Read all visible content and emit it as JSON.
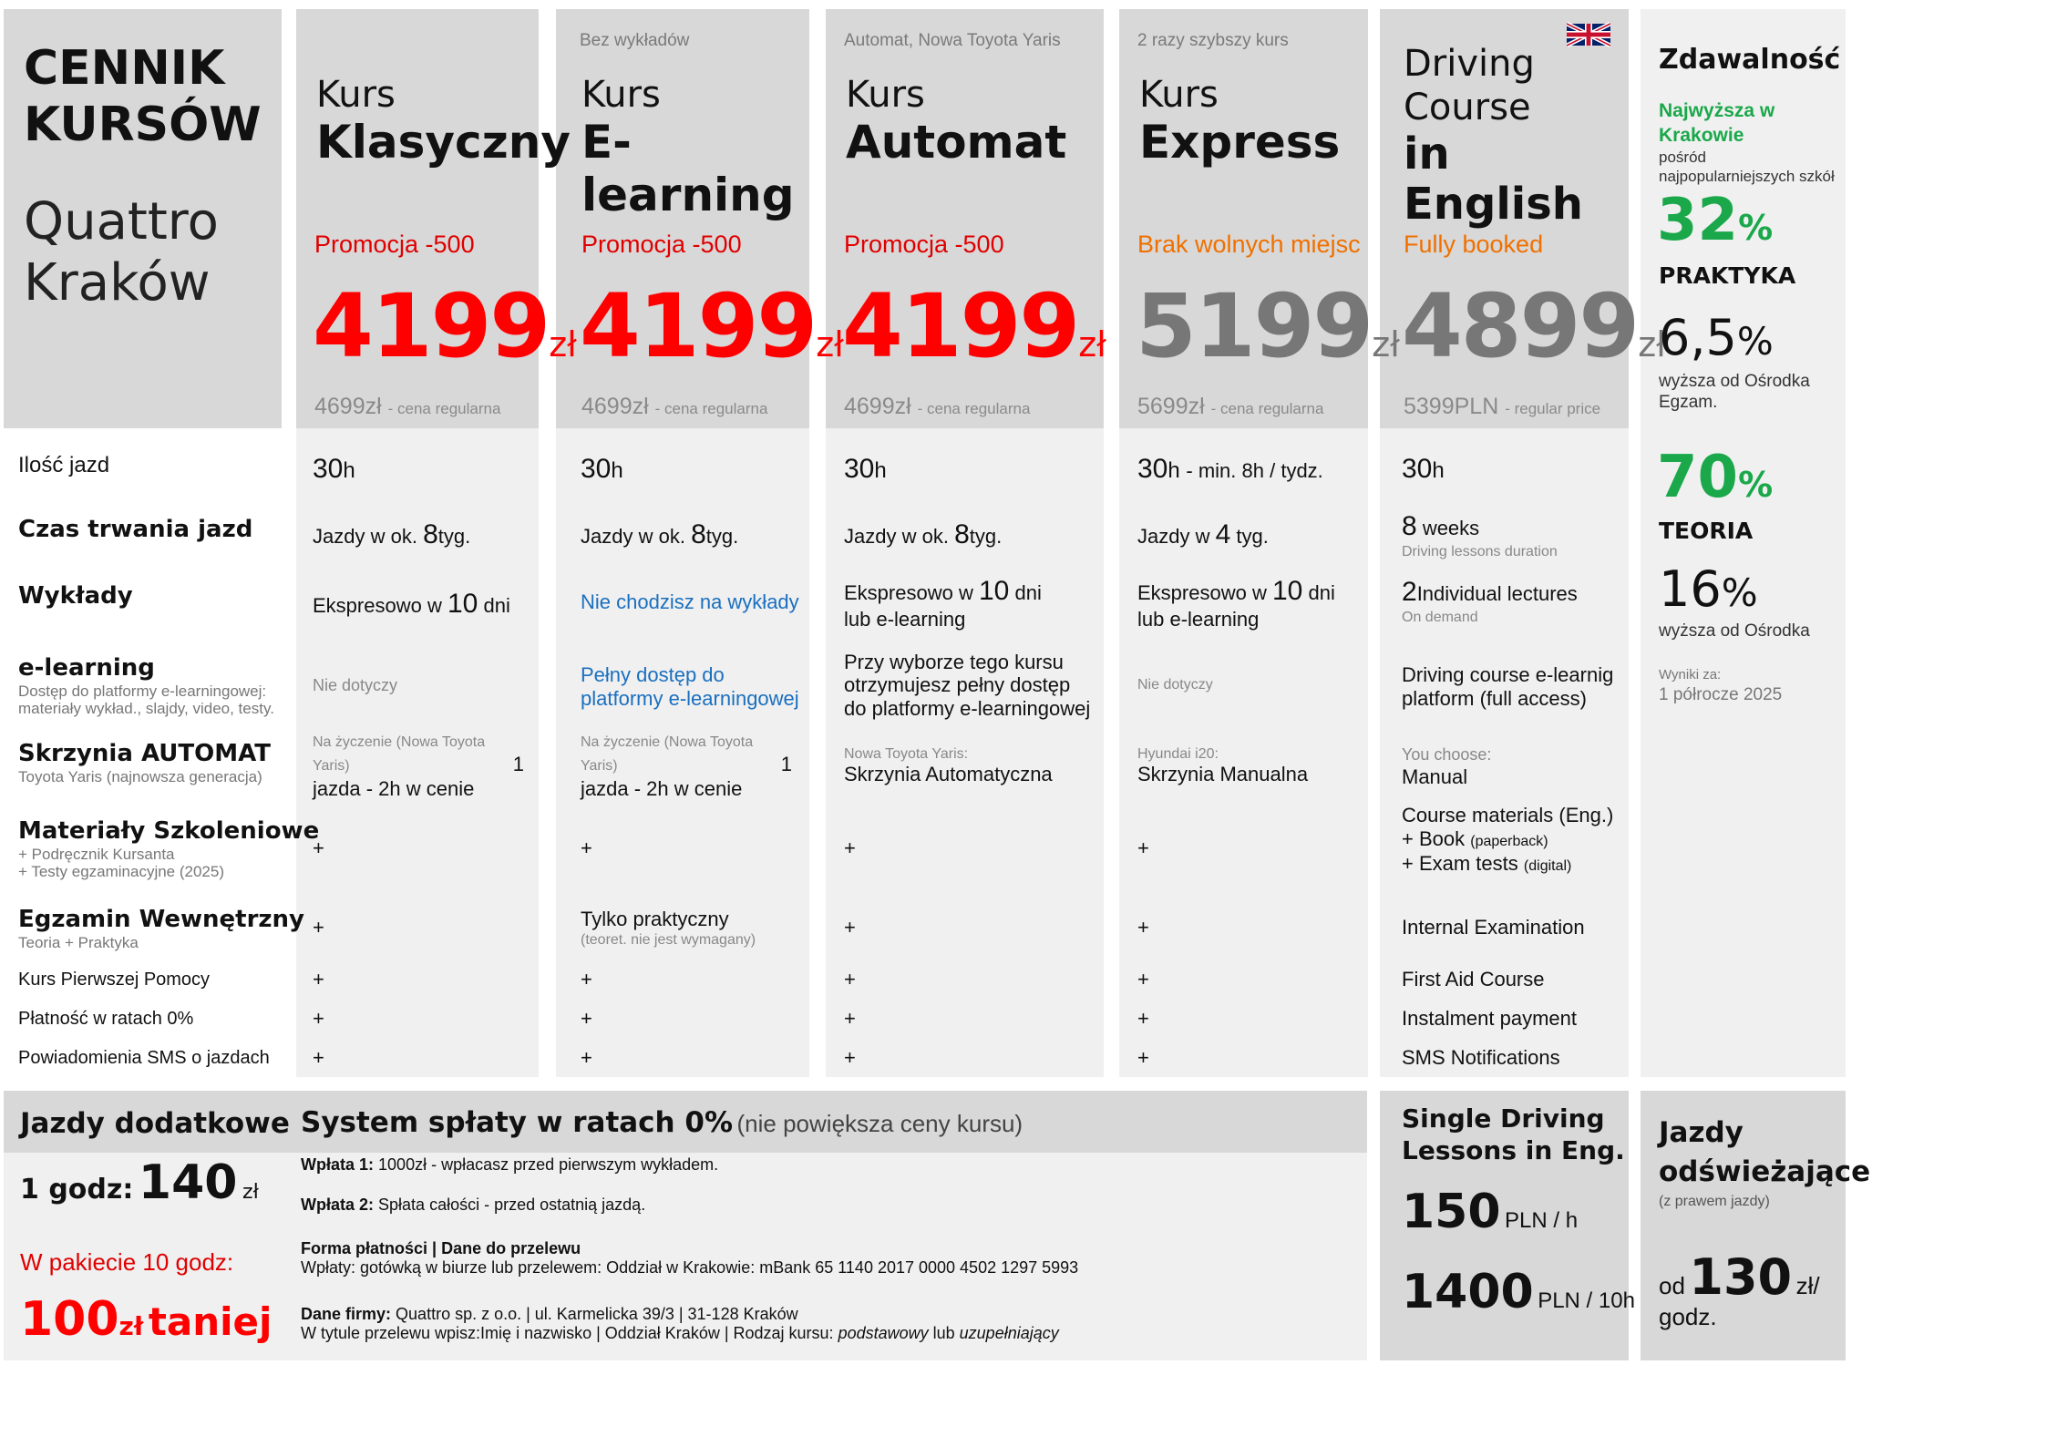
{
  "title": {
    "line1": "CENNIK",
    "line2": "KURSÓW",
    "sub1": "Quattro",
    "sub2": "Kraków"
  },
  "courses": [
    {
      "sup": "",
      "l1": "Kurs",
      "l2": "Klasyczny",
      "l3": "",
      "promo": "Promocja -500",
      "price": "4199",
      "unit": "zł",
      "reg": "4699zł",
      "reg_note": "- cena regularna"
    },
    {
      "sup": "Bez wykładów",
      "l1": "Kurs",
      "l2": "E-learning",
      "l3": "",
      "promo": "Promocja -500",
      "price": "4199",
      "unit": "zł",
      "reg": "4699zł",
      "reg_note": "- cena regularna"
    },
    {
      "sup": "Automat, Nowa Toyota Yaris",
      "l1": "Kurs",
      "l2": "Automat",
      "l3": "",
      "promo": "Promocja -500",
      "price": "4199",
      "unit": "zł",
      "reg": "4699zł",
      "reg_note": "- cena regularna"
    },
    {
      "sup": "2 razy szybszy kurs",
      "l1": "Kurs",
      "l2": "Express",
      "l3": "",
      "promo": "Brak wolnych miejsc",
      "price": "5199",
      "unit": "zł",
      "reg": "5699zł",
      "reg_note": "- cena regularna"
    },
    {
      "sup": "",
      "l1": "Driving",
      "l2": "Course",
      "l3": "in English",
      "promo": "Fully booked",
      "price": "4899",
      "unit": "zł",
      "reg": "5399PLN",
      "reg_note": "- regular price"
    }
  ],
  "labels": {
    "jazdy": "Ilość jazd",
    "czas": "Czas trwania jazd",
    "wyklady": "Wykłady",
    "elearning": "e-learning",
    "elearning_s1": "Dostęp do platformy e-learningowej:",
    "elearning_s2": "materiały wykład., slajdy, video, testy.",
    "skrzynia": "Skrzynia AUTOMAT",
    "skrzynia_s": "Toyota Yaris (najnowsza generacja)",
    "materialy": "Materiały Szkoleniowe",
    "materialy_s1": "+ Podręcznik Kursanta",
    "materialy_s2": "+ Testy egzaminacyjne (2025)",
    "egzamin": "Egzamin Wewnętrzny",
    "egzamin_s": "Teoria + Praktyka",
    "pomoc": "Kurs Pierwszej Pomocy",
    "platnosc": "Płatność w ratach 0%",
    "sms": "Powiadomienia SMS o jazdach"
  },
  "common": {
    "plus": "+",
    "h": "h",
    "thirty": "30",
    "jazdy_ok": "Jazdy w ok.",
    "eight": "8",
    "tyg": "tyg.",
    "ekspresowo": "Ekspresowo w",
    "ten": "10",
    "dni": "dni",
    "lub_el": "lub e-learning",
    "nie_dotyczy": "Nie dotyczy",
    "na_zyczenie": "Na życzenie (Nowa Toyota Yaris)",
    "one": "1",
    "jazda_2h": "jazda - 2h w cenie"
  },
  "c2": {
    "wyklady": "Nie chodzisz na wykłady",
    "el1": "Pełny dostęp do",
    "el2": "platformy e-learningowej",
    "egz": "Tylko praktyczny",
    "egz_s": "(teoret. nie jest wymagany)"
  },
  "c3": {
    "el1": "Przy wyborze tego kursu",
    "el2": "otrzymujesz pełny dostęp",
    "el3": "do platformy e-learningowej",
    "skr_s": "Nowa Toyota Yaris:",
    "skr": "Skrzynia Automatyczna"
  },
  "c4": {
    "min": "- min. 8h / tydz.",
    "jazdy_w": "Jazdy w",
    "four": "4",
    "skr_s": "Hyundai i20:",
    "skr": "Skrzynia Manualna"
  },
  "c5": {
    "eight": "8",
    "weeks": "weeks",
    "dur": "Driving lessons duration",
    "two": "2",
    "lect": "Individual lectures",
    "demand": "On demand",
    "el1": "Driving course e-learnig",
    "el2": "platform (full access)",
    "choose": "You choose:",
    "manual": "Manual",
    "mat1": "Course materials (Eng.)",
    "mat2": "+ Book",
    "mat2s": "(paperback)",
    "mat3": "+ Exam tests",
    "mat3s": "(digital)",
    "exam": "Internal Examination",
    "aid": "First Aid Course",
    "inst": "Instalment payment",
    "sms": "SMS Notifications"
  },
  "stats": {
    "title": "Zdawalność",
    "best1": "Najwyższa w",
    "best2": "Krakowie",
    "among1": "pośród",
    "among2": "najpopularniejszych szkół",
    "p1": "32",
    "pct": "%",
    "p1_label": "PRAKTYKA",
    "d1": "6,5",
    "d1_t1": "wyższa od Ośrodka",
    "d1_t2": "Egzam.",
    "p2": "70",
    "p2_label": "TEORIA",
    "d2": "16",
    "d2_t1": "wyższa od Ośrodka",
    "res1": "Wyniki za:",
    "res2": "1 półrocze 2025"
  },
  "extra": {
    "title": "Jazdy dodatkowe",
    "one_h": "1 godz:",
    "one_price": "140",
    "unit": "zł",
    "pack": "W pakiecie 10 godz:",
    "pack_price": "100",
    "pack_tail": "taniej"
  },
  "install": {
    "title": "System spłaty w ratach 0%",
    "title_note": "(nie powiększa ceny kursu)",
    "w1b": "Wpłata 1:",
    "w1": "1000zł  -  wpłacasz przed pierwszym wykładem.",
    "w2b": "Wpłata 2:",
    "w2": "Spłata całości - przed ostatnią jazdą.",
    "formb": "Forma płatności  |  Dane do przelewu",
    "form": "Wpłaty: gotówką w biurze lub przelewem: Oddział w Krakowie: mBank 65 1140 2017 0000 4502 1297 5993",
    "firmb": "Dane firmy:",
    "firm": "Quattro sp. z o.o.  |  ul. Karmelicka 39/3  |  31-128 Kraków",
    "tyt": "W tytule przelewu wpisz:Imię i nazwisko   |   Oddział  Kraków   |   Rodzaj kursu: ",
    "tyt_i1": "podstawowy",
    "tyt_lub": " lub ",
    "tyt_i2": "uzupełniający"
  },
  "single": {
    "title1": "Single Driving",
    "title2": "Lessons in Eng.",
    "p1": "150",
    "u1": "PLN / h",
    "p2": "1400",
    "u2": "PLN / 10h"
  },
  "refresh": {
    "t1": "Jazdy",
    "t2": "odświeżające",
    "note": "(z prawem jazdy)",
    "od": "od",
    "price": "130",
    "unit": "zł/",
    "godz": "godz."
  }
}
